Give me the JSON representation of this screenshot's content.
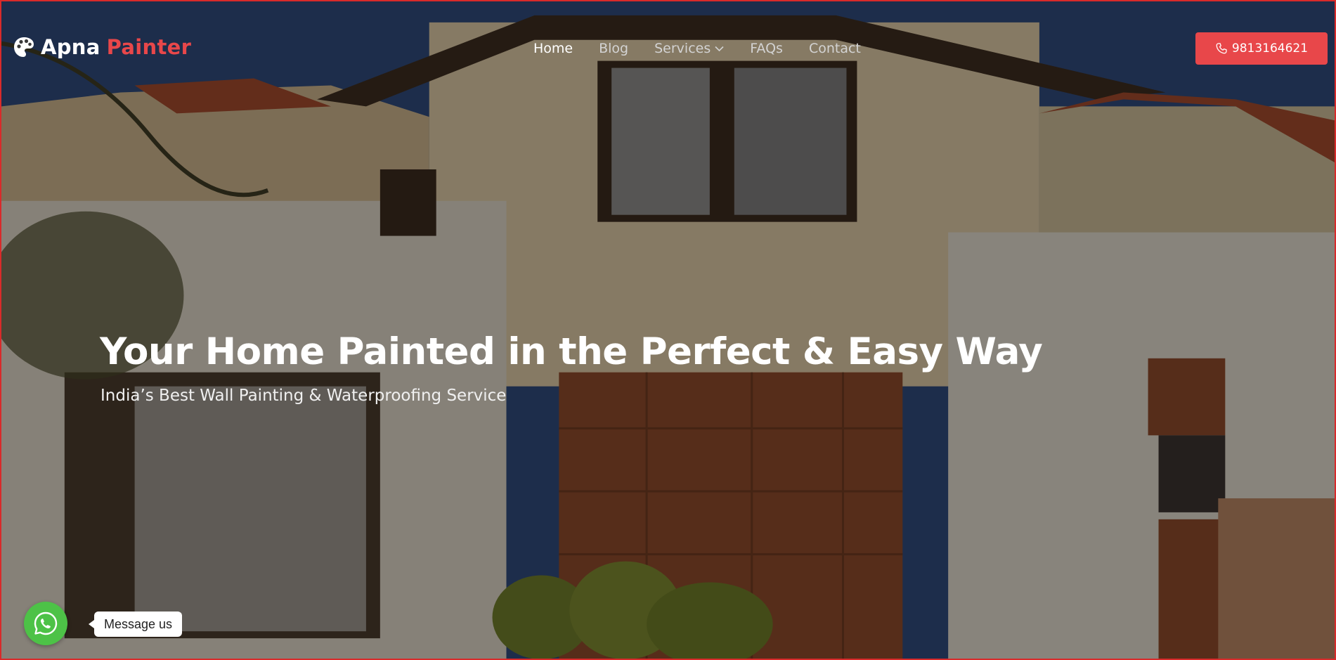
{
  "brand": {
    "word1": "Apna",
    "word2": "Painter",
    "accent_color": "#e8474a"
  },
  "nav": {
    "items": [
      {
        "label": "Home",
        "active": true
      },
      {
        "label": "Blog"
      },
      {
        "label": "Services",
        "has_dropdown": true
      },
      {
        "label": "FAQs"
      },
      {
        "label": "Contact"
      }
    ]
  },
  "phone_button": {
    "label": "9813164621",
    "icon": "phone-icon"
  },
  "hero": {
    "headline": "Your Home Painted in the Perfect & Easy Way",
    "subheadline": "India’s Best Wall Painting & Waterproofing Service"
  },
  "whatsapp": {
    "label": "Message us",
    "icon": "whatsapp-icon",
    "color": "#4dc247"
  }
}
